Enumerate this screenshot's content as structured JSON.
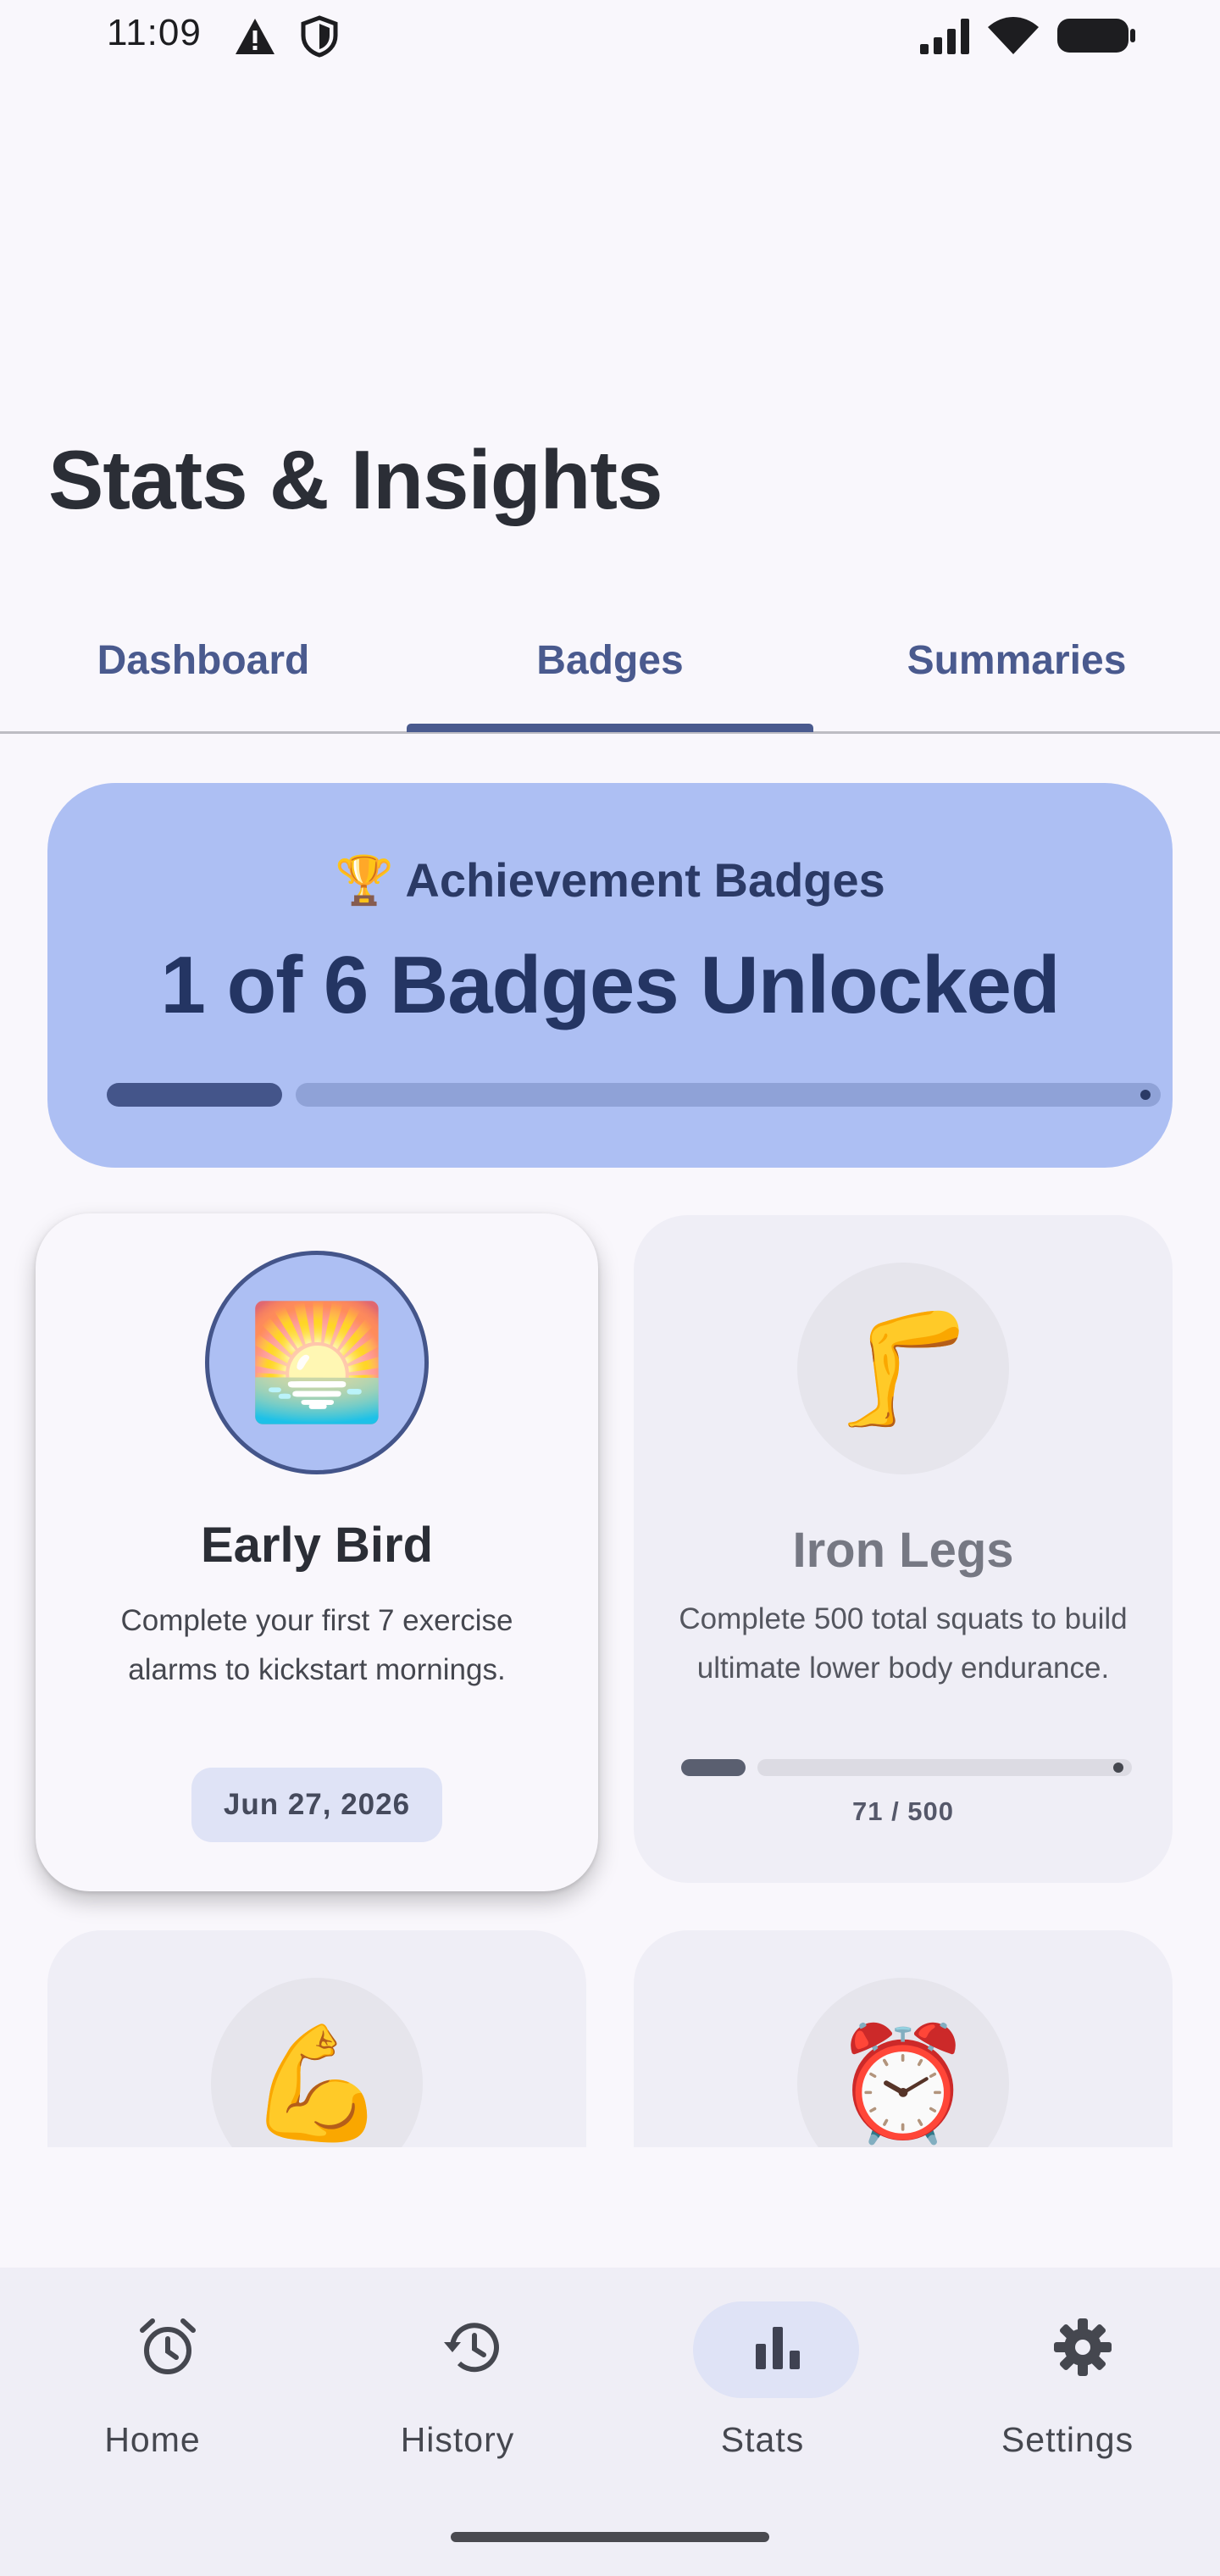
{
  "status_bar": {
    "time": "11:09",
    "icons": [
      "warning-icon",
      "shield-icon",
      "signal-icon",
      "wifi-icon",
      "battery-icon"
    ]
  },
  "page": {
    "title": "Stats & Insights"
  },
  "tabs": [
    {
      "label": "Dashboard",
      "selected": false
    },
    {
      "label": "Badges",
      "selected": true
    },
    {
      "label": "Summaries",
      "selected": false
    }
  ],
  "summary": {
    "heading": "🏆 Achievement Badges",
    "count_text": "1 of 6 Badges Unlocked",
    "unlocked": 1,
    "total": 6
  },
  "badges": [
    {
      "emoji": "🌅",
      "name": "Early Bird",
      "description": "Complete your first 7 exercise alarms to kickstart mornings.",
      "unlocked": true,
      "date": "Jun 27, 2026"
    },
    {
      "emoji": "🦵",
      "name": "Iron Legs",
      "description": "Complete 500 total squats to build ultimate lower body endurance.",
      "unlocked": false,
      "progress_text": "71 / 500",
      "progress_current": 71,
      "progress_total": 500
    },
    {
      "emoji": "💪",
      "unlocked": false
    },
    {
      "emoji": "⏰",
      "unlocked": false
    }
  ],
  "nav": [
    {
      "label": "Home",
      "icon": "alarm-clock-icon",
      "active": false
    },
    {
      "label": "History",
      "icon": "history-icon",
      "active": false
    },
    {
      "label": "Stats",
      "icon": "bar-chart-icon",
      "active": true
    },
    {
      "label": "Settings",
      "icon": "gear-icon",
      "active": false
    }
  ],
  "colors": {
    "accent": "#4a5a8e",
    "card_blue": "#adbff3",
    "text_dark": "#2b2e36",
    "text_locked": "#767883",
    "locked_card": "#efeef6"
  }
}
